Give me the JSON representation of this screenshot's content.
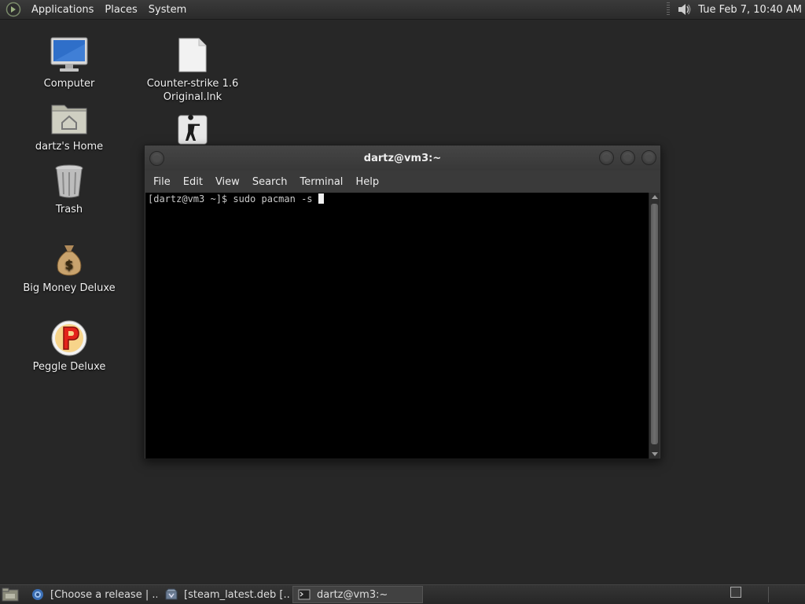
{
  "top_panel": {
    "menus": [
      "Applications",
      "Places",
      "System"
    ],
    "clock": "Tue Feb  7, 10:40 AM"
  },
  "desktop_icons": [
    {
      "label": "Computer",
      "icon": "computer-icon"
    },
    {
      "label": "dartz's Home",
      "icon": "home-folder-icon"
    },
    {
      "label": "Trash",
      "icon": "trash-icon"
    },
    {
      "label": "Big Money Deluxe",
      "icon": "money-bag-icon"
    },
    {
      "label": "Peggle Deluxe",
      "icon": "peggle-icon"
    },
    {
      "label": "Counter-strike 1.6 Original.lnk",
      "icon": "file-icon"
    },
    {
      "label": "",
      "icon": "counter-strike-icon"
    }
  ],
  "terminal": {
    "title": "dartz@vm3:~",
    "menus": [
      "File",
      "Edit",
      "View",
      "Search",
      "Terminal",
      "Help"
    ],
    "prompt": "[dartz@vm3 ~]$ sudo pacman -s ",
    "colors": {
      "background": "#000000",
      "text": "#c8c8c8"
    }
  },
  "taskbar": {
    "tasks": [
      {
        "label": "[Choose a release | ...",
        "icon": "browser-icon",
        "active": false
      },
      {
        "label": "[steam_latest.deb [...",
        "icon": "package-icon",
        "active": false
      },
      {
        "label": "dartz@vm3:~",
        "icon": "terminal-icon",
        "active": true
      }
    ]
  }
}
